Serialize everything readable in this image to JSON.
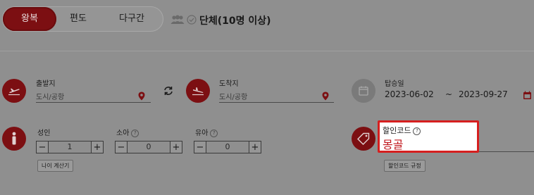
{
  "trip_type": {
    "tabs": [
      {
        "label": "왕복",
        "active": true
      },
      {
        "label": "편도",
        "active": false
      },
      {
        "label": "다구간",
        "active": false
      }
    ],
    "group_option": {
      "label": "단체(10명 이상)",
      "checked": false,
      "icon": "group-icon"
    }
  },
  "route": {
    "origin": {
      "label": "출발지",
      "placeholder": "도시/공항",
      "icon": "plane-depart-icon"
    },
    "destination": {
      "label": "도착지",
      "placeholder": "도시/공항",
      "icon": "plane-arrive-icon"
    },
    "swap_icon": "swap-icon",
    "location_pin_icon": "map-pin-icon"
  },
  "dates": {
    "label": "탑승일",
    "start": "2023-06-02",
    "separator": "~",
    "end": "2023-09-27",
    "icon": "calendar-icon"
  },
  "passengers": {
    "icon": "person-icon",
    "adult": {
      "label": "성인",
      "value": "1"
    },
    "child": {
      "label": "소아",
      "value": "0"
    },
    "infant": {
      "label": "유아",
      "value": "0"
    },
    "minus_symbol": "−",
    "plus_symbol": "+",
    "age_calc_button": "나이 계산기"
  },
  "promo": {
    "label": "할인코드",
    "value": "몽골",
    "rules_button": "할인코드 규정",
    "icon": "tag-icon"
  },
  "colors": {
    "brand": "#7c0f12",
    "highlight_border": "#d61f1f",
    "promo_text": "#c0141a"
  }
}
